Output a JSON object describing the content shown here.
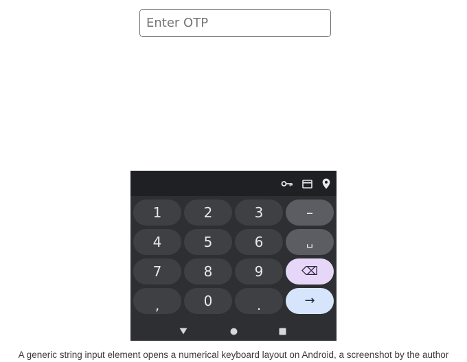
{
  "otp_input": {
    "placeholder": "Enter OTP",
    "value": ""
  },
  "keyboard": {
    "suggestion_icons": [
      "key-icon",
      "credit-card-icon",
      "location-pin-icon"
    ],
    "rows": [
      [
        {
          "label": "1",
          "kind": "digit"
        },
        {
          "label": "2",
          "kind": "digit"
        },
        {
          "label": "3",
          "kind": "digit"
        },
        {
          "label": "–",
          "kind": "function"
        }
      ],
      [
        {
          "label": "4",
          "kind": "digit"
        },
        {
          "label": "5",
          "kind": "digit"
        },
        {
          "label": "6",
          "kind": "digit"
        },
        {
          "label": "␣",
          "kind": "function"
        }
      ],
      [
        {
          "label": "7",
          "kind": "digit"
        },
        {
          "label": "8",
          "kind": "digit"
        },
        {
          "label": "9",
          "kind": "digit"
        },
        {
          "label": "⌫",
          "kind": "backspace"
        }
      ],
      [
        {
          "label": ",",
          "kind": "punct"
        },
        {
          "label": "0",
          "kind": "digit"
        },
        {
          "label": ".",
          "kind": "punct"
        },
        {
          "label": "→",
          "kind": "enter"
        }
      ]
    ],
    "nav_icons": [
      "back-icon",
      "home-icon",
      "recents-icon"
    ]
  },
  "colors": {
    "keyboard_bg": "#2d2f32",
    "suggestion_bg": "#1f2023",
    "key_bg": "#3e4044",
    "function_key_bg": "#5b5d62",
    "backspace_bg": "#e6d6f7",
    "enter_bg": "#d6e5fb"
  },
  "caption": "A generic string input element opens a numerical keyboard layout on Android, a screenshot by the author"
}
